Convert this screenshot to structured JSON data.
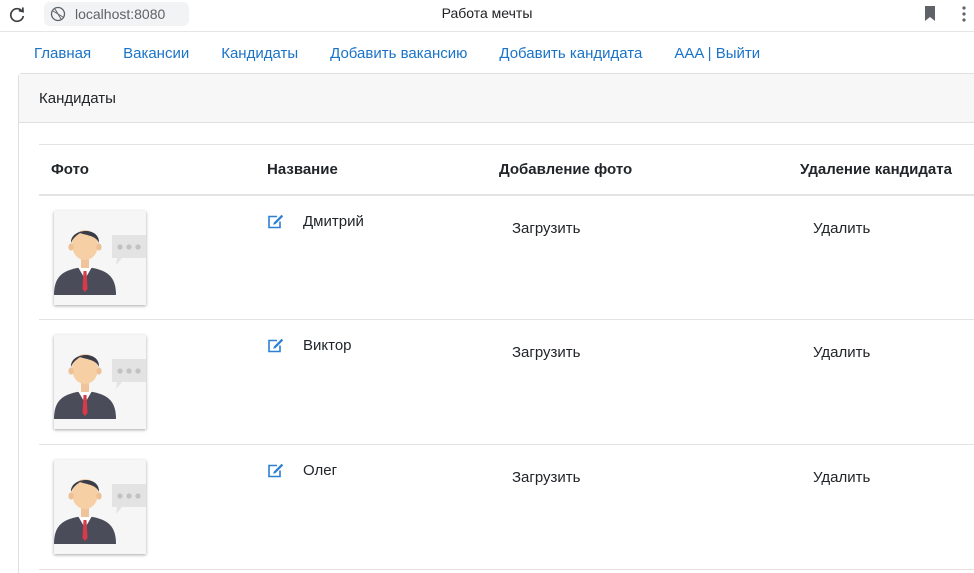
{
  "browser": {
    "url": "localhost:8080",
    "tab_title": "Работа мечты"
  },
  "nav": {
    "items": [
      "Главная",
      "Вакансии",
      "Кандидаты",
      "Добавить вакансию",
      "Добавить кандидата",
      "AAA | Выйти"
    ]
  },
  "card": {
    "title": "Кандидаты"
  },
  "table": {
    "headers": [
      "Фото",
      "Название",
      "Добавление фото",
      "Удаление кандидата"
    ],
    "rows": [
      {
        "name": "Дмитрий",
        "upload_label": "Загрузить",
        "delete_label": "Удалить"
      },
      {
        "name": "Виктор",
        "upload_label": "Загрузить",
        "delete_label": "Удалить"
      },
      {
        "name": "Олег",
        "upload_label": "Загрузить",
        "delete_label": "Удалить"
      }
    ]
  },
  "icons": {
    "reload": "reload-icon",
    "site": "globe-icon",
    "bookmark": "bookmark-icon",
    "edit": "edit-icon",
    "avatar": "avatar-placeholder"
  },
  "colors": {
    "link": "#1a73c8",
    "header_bg": "#f7f7f7",
    "border": "#dfdfdf"
  }
}
